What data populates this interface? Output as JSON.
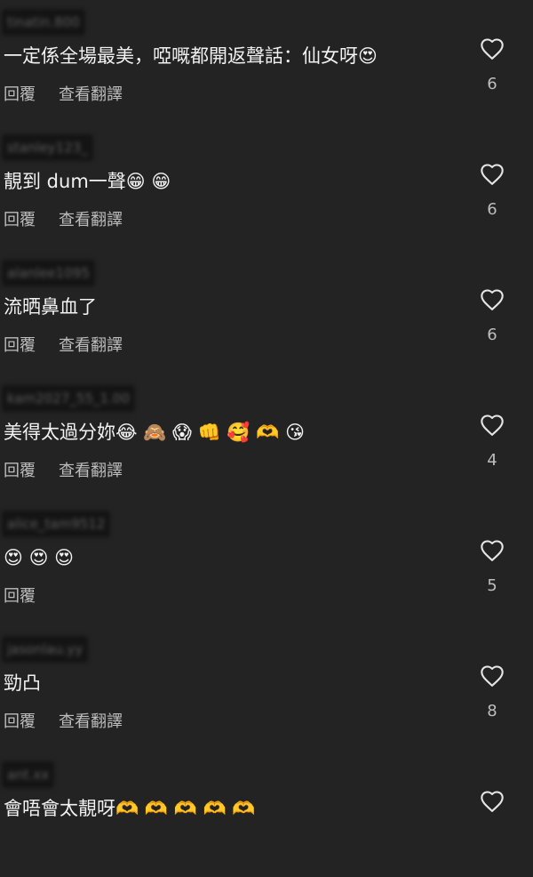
{
  "comments": [
    {
      "username": "tinatin.800",
      "text": "一定係全場最美，啞嘅都開返聲話：仙女呀😍",
      "reply": "回覆",
      "translate": "查看翻譯",
      "likes": "6"
    },
    {
      "username": "stanley123_",
      "text": "靚到 dum一聲😁 😁",
      "reply": "回覆",
      "translate": "查看翻譯",
      "likes": "6"
    },
    {
      "username": "alanlee1095",
      "text": "流晒鼻血了",
      "reply": "回覆",
      "translate": "查看翻譯",
      "likes": "6"
    },
    {
      "username": "kam2027_55_1.00",
      "text": "美得太過分妳😂 🙈 😱 👊 🥰 🫶 😘",
      "reply": "回覆",
      "translate": "查看翻譯",
      "likes": "4"
    },
    {
      "username": "alice_tam9512",
      "text": "😍 😍 😍",
      "reply": "回覆",
      "translate": "",
      "likes": "5"
    },
    {
      "username": "jasonlau.yy",
      "text": "勁凸",
      "reply": "回覆",
      "translate": "查看翻譯",
      "likes": "8"
    },
    {
      "username": "ant.xx",
      "text": "會唔會太靚呀🫶 🫶 🫶 🫶 🫶",
      "reply": "",
      "translate": "",
      "likes": ""
    }
  ],
  "icons": {
    "like": "heart-outline-icon"
  },
  "colors": {
    "background": "#232323",
    "text": "#f2f2f2",
    "secondary_text": "#bdbdbd"
  }
}
